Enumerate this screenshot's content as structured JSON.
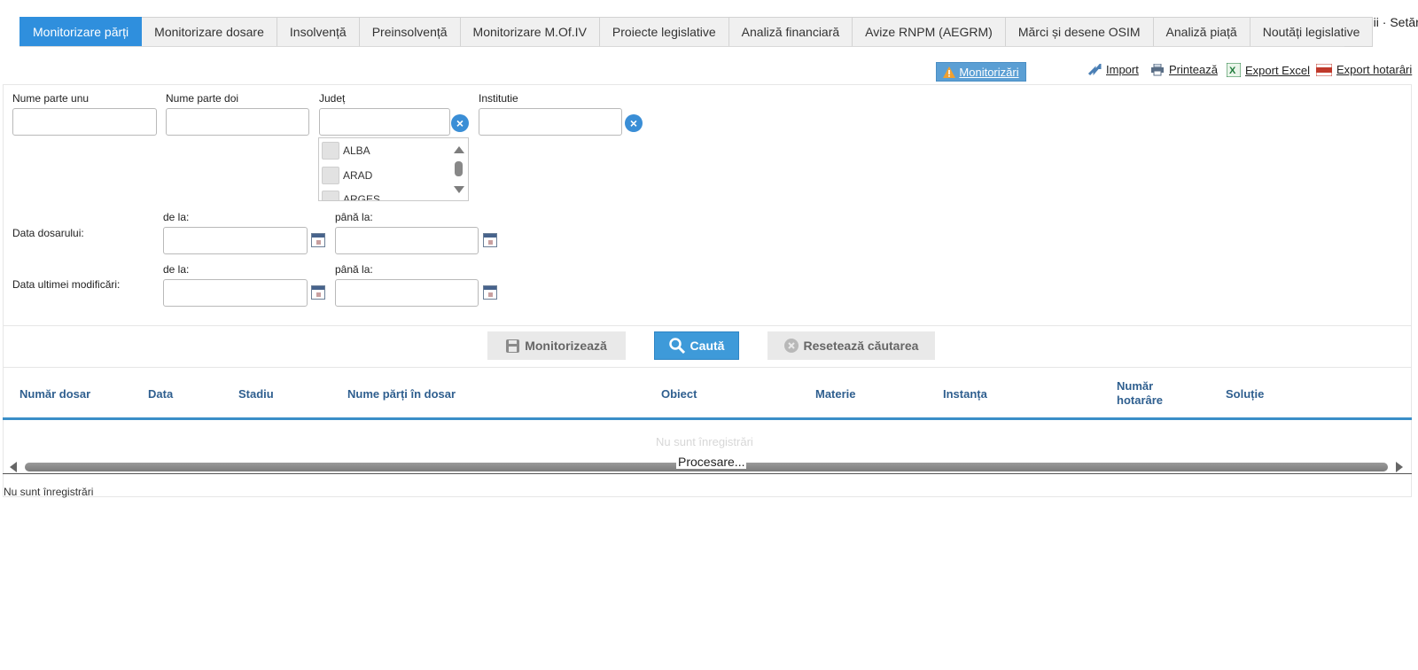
{
  "header": {
    "top_right": "Detalii · Setări"
  },
  "tabs": [
    {
      "label": "Monitorizare părți",
      "active": true
    },
    {
      "label": "Monitorizare dosare"
    },
    {
      "label": "Insolvență"
    },
    {
      "label": "Preinsolvență"
    },
    {
      "label": "Monitorizare M.Of.IV"
    },
    {
      "label": "Proiecte legislative"
    },
    {
      "label": "Analiză financiară"
    },
    {
      "label": "Avize RNPM (AEGRM)"
    },
    {
      "label": "Mărci și desene OSIM"
    },
    {
      "label": "Analiză piață"
    },
    {
      "label": "Noutăți legislative"
    }
  ],
  "toolbar": {
    "monitorizari": "Monitorizări",
    "import": "Import",
    "print": "Printează",
    "export_excel": "Export Excel",
    "export_hotarari": "Export hotarâri"
  },
  "form": {
    "nume_parte_unu": {
      "label": "Nume parte unu",
      "value": ""
    },
    "nume_parte_doi": {
      "label": "Nume parte doi",
      "value": ""
    },
    "judet": {
      "label": "Județ",
      "value": "",
      "options": [
        "ALBA",
        "ARAD",
        "ARGES"
      ]
    },
    "institutie": {
      "label": "Institutie",
      "value": ""
    },
    "data_dosarului": {
      "label": "Data dosarului:",
      "from_label": "de la:",
      "to_label": "până la:"
    },
    "data_modificari": {
      "label": "Data ultimei modificări:",
      "from_label": "de la:",
      "to_label": "până la:"
    }
  },
  "buttons": {
    "monitorizeaza": "Monitorizează",
    "cauta": "Caută",
    "reseteaza": "Resetează căutarea"
  },
  "table": {
    "columns": [
      "Număr dosar",
      "Data",
      "Stadiu",
      "Nume părți în dosar",
      "Obiect",
      "Materie",
      "Instanța",
      "Număr hotarâre",
      "Soluție"
    ],
    "empty_text": "Nu sunt înregistrări",
    "processing": "Procesare..."
  },
  "footer": {
    "info": "Nu sunt înregistrări"
  },
  "colors": {
    "accent": "#2f8fdd",
    "header_text": "#2f5f8f"
  }
}
